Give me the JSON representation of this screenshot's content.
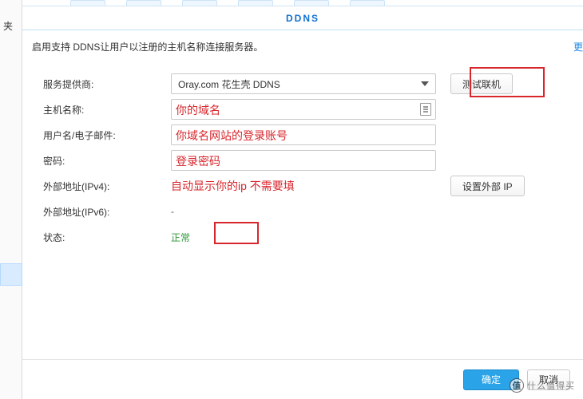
{
  "left_fragment": "夹",
  "header": {
    "title": "DDNS"
  },
  "desc": "启用支持 DDNS让用户以注册的主机名称连接服务器。",
  "more_link": "更",
  "form": {
    "provider_label": "服务提供商:",
    "provider_value": "Oray.com 花生壳 DDNS",
    "test_btn": "测试联机",
    "hostname_label": "主机名称:",
    "hostname_hint": "你的域名",
    "user_label": "用户名/电子邮件:",
    "user_hint": "你域名网站的登录账号",
    "password_label": "密码:",
    "password_hint": "登录密码",
    "ipv4_label": "外部地址(IPv4):",
    "ipv4_hint": "自动显示你的ip 不需要填",
    "setip_btn": "设置外部 IP",
    "ipv6_label": "外部地址(IPv6):",
    "ipv6_value": "-",
    "status_label": "状态:",
    "status_value": "正常"
  },
  "footer": {
    "ok": "确定",
    "cancel": "取消"
  },
  "watermark": {
    "badge": "值",
    "text": "什么值得买"
  }
}
